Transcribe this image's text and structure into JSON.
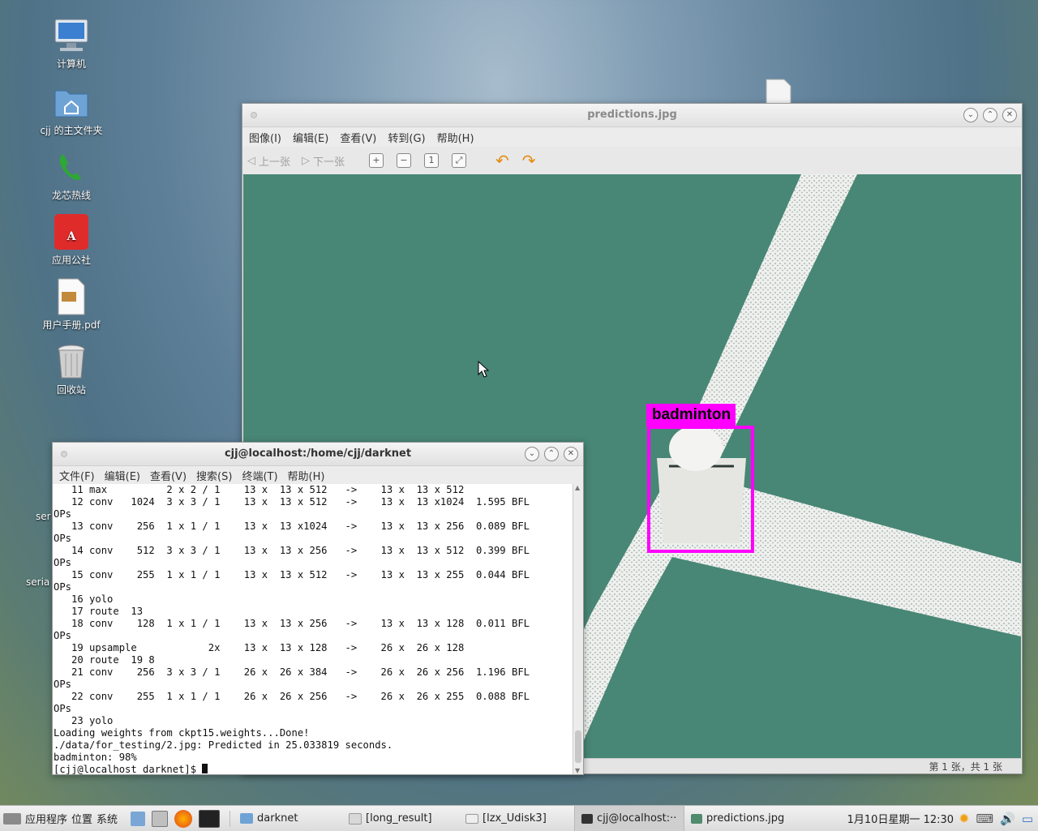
{
  "desktop": {
    "icons": [
      {
        "label": "计算机"
      },
      {
        "label": "cjj 的主文件夹"
      },
      {
        "label": "龙芯热线"
      },
      {
        "label": "应用公社"
      },
      {
        "label": "用户手册.pdf"
      },
      {
        "label": "回收站"
      }
    ],
    "partial_labels": [
      "ser",
      "seria"
    ]
  },
  "viewer": {
    "title": "predictions.jpg",
    "menu": [
      "图像(I)",
      "编辑(E)",
      "查看(V)",
      "转到(G)",
      "帮助(H)"
    ],
    "toolbar": {
      "prev": "上一张",
      "next": "下一张"
    },
    "detection_label": "badminton",
    "detection_color": "#ff00ff",
    "status": "第 1 张，共 1 张"
  },
  "terminal": {
    "title": "cjj@localhost:/home/cjj/darknet",
    "menu": [
      "文件(F)",
      "编辑(E)",
      "查看(V)",
      "搜索(S)",
      "终端(T)",
      "帮助(H)"
    ],
    "lines": [
      "   11 max          2 x 2 / 1    13 x  13 x 512   ->    13 x  13 x 512",
      "   12 conv   1024  3 x 3 / 1    13 x  13 x 512   ->    13 x  13 x1024  1.595 BFL",
      "OPs",
      "   13 conv    256  1 x 1 / 1    13 x  13 x1024   ->    13 x  13 x 256  0.089 BFL",
      "OPs",
      "   14 conv    512  3 x 3 / 1    13 x  13 x 256   ->    13 x  13 x 512  0.399 BFL",
      "OPs",
      "   15 conv    255  1 x 1 / 1    13 x  13 x 512   ->    13 x  13 x 255  0.044 BFL",
      "OPs",
      "   16 yolo",
      "   17 route  13",
      "   18 conv    128  1 x 1 / 1    13 x  13 x 256   ->    13 x  13 x 128  0.011 BFL",
      "OPs",
      "   19 upsample            2x    13 x  13 x 128   ->    26 x  26 x 128",
      "   20 route  19 8",
      "   21 conv    256  3 x 3 / 1    26 x  26 x 384   ->    26 x  26 x 256  1.196 BFL",
      "OPs",
      "   22 conv    255  1 x 1 / 1    26 x  26 x 256   ->    26 x  26 x 255  0.088 BFL",
      "OPs",
      "   23 yolo",
      "Loading weights from ckpt15.weights...Done!",
      "./data/for_testing/2.jpg: Predicted in 25.033819 seconds.",
      "badminton: 98%"
    ],
    "prompt": "[cjj@localhost darknet]$ "
  },
  "taskbar": {
    "menus": [
      "应用程序",
      "位置",
      "系统"
    ],
    "tasks": [
      {
        "label": "darknet"
      },
      {
        "label": "[long_result]"
      },
      {
        "label": "[lzx_Udisk3]"
      },
      {
        "label": "cjj@localhost:··"
      },
      {
        "label": "predictions.jpg"
      }
    ],
    "clock": "1月10日星期一 12:30"
  }
}
